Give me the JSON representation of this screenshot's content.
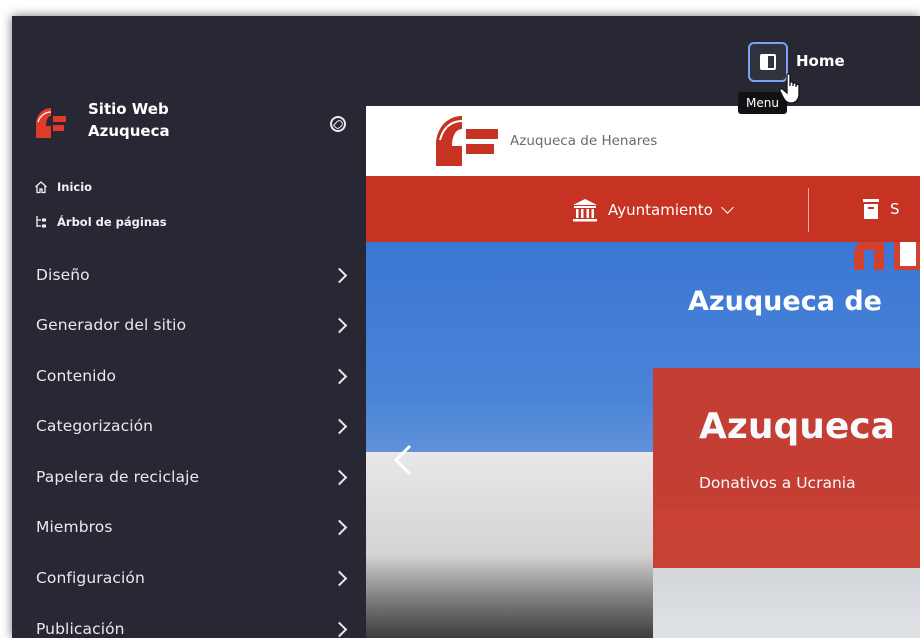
{
  "sidebar": {
    "site_name_line1": "Sitio Web",
    "site_name_line2": "Azuqueca",
    "quick_links": [
      {
        "label": "Inicio",
        "icon": "home-icon"
      },
      {
        "label": "Árbol de páginas",
        "icon": "page-tree-icon"
      }
    ],
    "items": [
      {
        "label": "Diseño"
      },
      {
        "label": "Generador del sitio"
      },
      {
        "label": "Contenido"
      },
      {
        "label": "Categorización"
      },
      {
        "label": "Papelera de reciclaje"
      },
      {
        "label": "Miembros"
      },
      {
        "label": "Configuración"
      },
      {
        "label": "Publicación"
      }
    ]
  },
  "topbar": {
    "home_label": "Home",
    "tooltip": "Menu"
  },
  "site": {
    "brand": "Azuqueca de Henares",
    "menu": [
      {
        "label": "Ayuntamiento"
      },
      {
        "label": "S"
      }
    ],
    "hero_title": "Azuqueca de",
    "panel_title": "Azuqueca",
    "panel_subtitle": "Donativos a Ucrania"
  },
  "colors": {
    "sidebar_bg": "#272833",
    "accent_red": "#c73322",
    "toggle_border": "#7fa1f0"
  }
}
